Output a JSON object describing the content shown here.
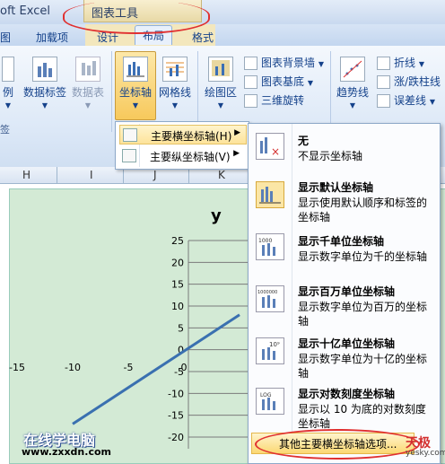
{
  "title_bar": {
    "app_title": "oft Excel",
    "context_group": "图表工具"
  },
  "tabs": [
    "图",
    "加载项",
    "设计",
    "布局",
    "格式"
  ],
  "ribbon": {
    "buttons": [
      "例",
      "数据标签",
      "数据表",
      "坐标轴",
      "网格线",
      "绘图区",
      "趋势线"
    ],
    "small_items": [
      "图表背景墙",
      "图表基底",
      "三维旋转",
      "折线",
      "涨/跌柱线",
      "误差线"
    ],
    "group_label": "签"
  },
  "axis_submenu": {
    "items": [
      {
        "label": "主要横坐标轴(H)",
        "highlighted": true
      },
      {
        "label": "主要纵坐标轴(V)",
        "highlighted": false
      }
    ]
  },
  "sheet": {
    "columns": [
      "H",
      "I",
      "J",
      "K"
    ]
  },
  "dropdown": {
    "items": [
      {
        "icon": "no-axis-icon",
        "title": "无",
        "desc": "不显示坐标轴"
      },
      {
        "icon": "default-axis-icon",
        "title": "显示默认坐标轴",
        "desc": "显示使用默认顺序和标签的坐标轴"
      },
      {
        "icon": "thousands-axis-icon",
        "title": "显示千单位坐标轴",
        "desc": "显示数字单位为千的坐标轴",
        "icon_text": "1000"
      },
      {
        "icon": "millions-axis-icon",
        "title": "显示百万单位坐标轴",
        "desc": "显示数字单位为百万的坐标轴",
        "icon_text": "1000000"
      },
      {
        "icon": "billions-axis-icon",
        "title": "显示十亿单位坐标轴",
        "desc": "显示数字单位为十亿的坐标轴",
        "icon_text": "10⁹"
      },
      {
        "icon": "log-axis-icon",
        "title": "显示对数刻度坐标轴",
        "desc": "显示以 10 为底的对数刻度坐标轴",
        "icon_text": "LOG"
      }
    ],
    "more_options": "其他主要横坐标轴选项..."
  },
  "chart_data": {
    "type": "line",
    "title": "y",
    "x_ticks": [
      -15,
      -10,
      -5,
      0
    ],
    "y_ticks": [
      25,
      20,
      15,
      10,
      5,
      0,
      -5,
      -10,
      -15,
      -20
    ],
    "ylim": [
      -20,
      25
    ],
    "series": [
      {
        "x": [
          -10,
          5
        ],
        "y": [
          -17,
          8
        ]
      }
    ],
    "line_color": "#3a70b0",
    "grid": true
  },
  "watermarks": {
    "site_name": "在线学电脑",
    "site_url": "www.zxxdn.com",
    "brand": "天极",
    "brand_url": "yesky.com"
  }
}
